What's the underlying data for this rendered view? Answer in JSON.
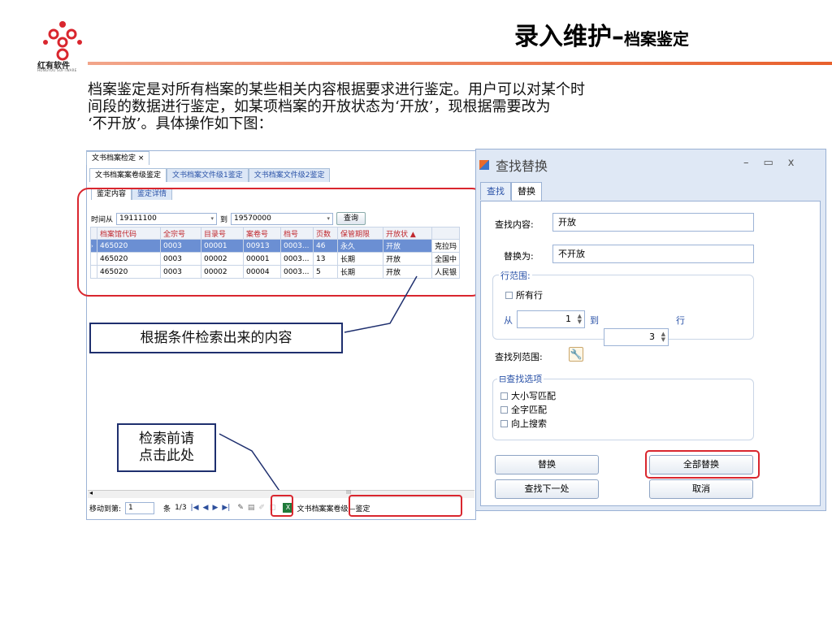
{
  "header": {
    "logo_text": "红有软件",
    "logo_subtext": "HONGYOU SOFTWARE",
    "title_main": "录入维护–",
    "title_sub": "档案鉴定"
  },
  "description": {
    "line1": "档案鉴定是对所有档案的某些相关内容根据要求进行鉴定。用户可以对某个时",
    "line2": "间段的数据进行鉴定，如某项档案的开放状态为‘开放’，现根据需要改为",
    "line3": "‘不开放’。具体操作如下图："
  },
  "left_window": {
    "doc_tab": "文书档案检定 ×",
    "sub_tabs": [
      "文书档案案卷级鉴定",
      "文书档案文件级1鉴定",
      "文书档案文件级2鉴定"
    ],
    "inner_tabs": [
      "鉴定内容",
      "鉴定详情"
    ],
    "filter": {
      "from_label": "时间从",
      "from_value": "19111100",
      "to_label": "到",
      "to_value": "19570000",
      "query_button": "查询"
    },
    "table": {
      "columns": [
        "档案馆代码",
        "全宗号",
        "目录号",
        "案卷号",
        "档号",
        "页数",
        "保管期限",
        "开放状 ▲",
        ""
      ],
      "rows": [
        [
          "465020",
          "0003",
          "00001",
          "00913",
          "0003...",
          "46",
          "永久",
          "开放",
          "克拉玛"
        ],
        [
          "465020",
          "0003",
          "00002",
          "00001",
          "0003...",
          "13",
          "长期",
          "开放",
          "全国中"
        ],
        [
          "465020",
          "0003",
          "00002",
          "00004",
          "0003...",
          "5",
          "长期",
          "开放",
          "人民银"
        ]
      ]
    },
    "status_bar": {
      "goto_label": "移动到第:",
      "goto_value": "1",
      "unit": "条",
      "page": "1/3",
      "report_label": "文书档案案卷级—鉴定"
    },
    "scroll_marker": "III"
  },
  "callouts": {
    "result_note": "根据条件检索出来的内容",
    "click_note_line1": "检索前请",
    "click_note_line2": "点击此处"
  },
  "dialog": {
    "title": "查找替换",
    "tabs": [
      "查找",
      "替换"
    ],
    "find_label": "查找内容:",
    "find_value": "开放",
    "replace_label": "替换为:",
    "replace_value": "不开放",
    "row_range_legend": "行范围:",
    "all_rows_label": "所有行",
    "from_label": "从",
    "from_value": "1",
    "to_label": "到",
    "to_value": "3",
    "row_unit": "行",
    "column_range_label": "查找列范围:",
    "options_legend": "⊟查找选项",
    "options": [
      "大小写匹配",
      "全字匹配",
      "向上搜索"
    ],
    "buttons": {
      "replace": "替换",
      "replace_all": "全部替换",
      "find_next": "查找下一处",
      "cancel": "取消"
    },
    "window_controls": [
      "–",
      "▭",
      "x"
    ]
  },
  "colors": {
    "accent_red": "#d9262e",
    "link_blue": "#2b53a8",
    "selected_row": "#6b8fd3",
    "header_line": "#e8602c"
  }
}
